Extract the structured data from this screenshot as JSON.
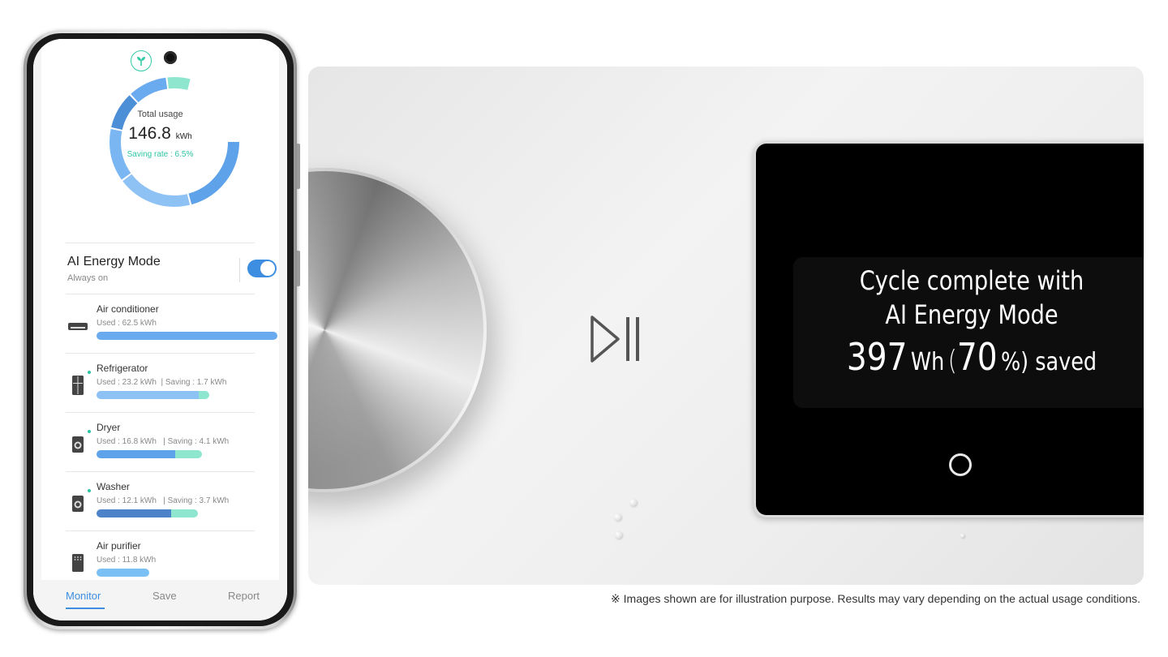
{
  "phone": {
    "summary": {
      "total_label": "Total usage",
      "total_value": "146.8",
      "total_unit": "kWh",
      "saving_rate": "Saving rate : 6.5%"
    },
    "ai_mode": {
      "title": "AI Energy Mode",
      "subtitle": "Always on",
      "enabled": true
    },
    "devices": [
      {
        "name": "Air conditioner",
        "used": "Used : 62.5 kWh",
        "saving": "",
        "icon": "air-conditioner-icon"
      },
      {
        "name": "Refrigerator",
        "used": "Used : 23.2 kWh",
        "saving": "|  Saving : 1.7 kWh",
        "icon": "refrigerator-icon"
      },
      {
        "name": "Dryer",
        "used": "Used : 16.8 kWh",
        "saving": "|  Saving : 4.1 kWh",
        "icon": "dryer-icon"
      },
      {
        "name": "Washer",
        "used": "Used : 12.1 kWh",
        "saving": "|  Saving : 3.7 kWh",
        "icon": "washer-icon"
      },
      {
        "name": "Air purifier",
        "used": "Used : 11.8 kWh",
        "saving": "",
        "icon": "air-purifier-icon"
      }
    ],
    "tabs": [
      {
        "label": "Monitor",
        "active": true
      },
      {
        "label": "Save",
        "active": false
      },
      {
        "label": "Report",
        "active": false
      }
    ]
  },
  "panel": {
    "line1": "Cycle complete with",
    "line2": "AI Energy Mode",
    "saved_value": "397",
    "saved_unit": "Wh",
    "open_paren": "(",
    "saved_percent": "70",
    "percent_sign": "%",
    "saved_suffix": ") saved"
  },
  "disclaimer": "※ Images shown are for illustration purpose. Results may vary depending on the actual usage conditions.",
  "colors": {
    "accent_blue": "#3d8ee0",
    "light_blue": "#7ab6f2",
    "saving_green": "#2ec4a4",
    "mint": "#8fe6cf"
  }
}
